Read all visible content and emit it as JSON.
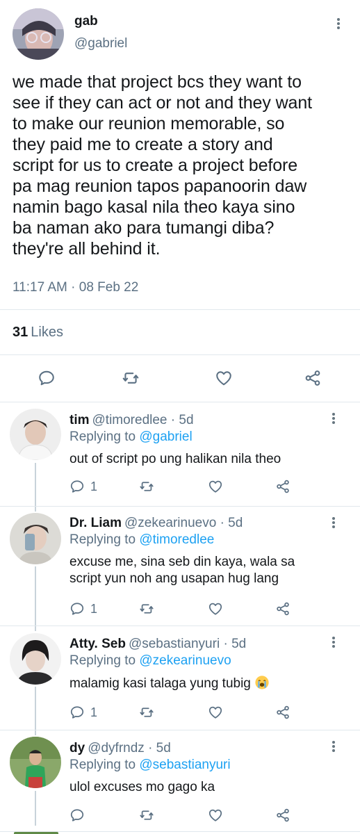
{
  "main_tweet": {
    "name": "gab",
    "handle": "@gabriel",
    "text_lines": [
      "we made that project bcs they want to",
      "see if they can act or not and they want",
      "to make our reunion memorable, so",
      "they paid me to create a story and",
      "script for us to create a project before",
      "pa mag reunion tapos papanoorin daw",
      "namin bago kasal nila theo kaya sino",
      "ba naman ako para tumangi diba?",
      "they're all behind it."
    ],
    "timestamp": "11:17 AM · 08 Feb 22",
    "likes_count": "31",
    "likes_label": "Likes",
    "icons": {
      "reply": "reply-icon",
      "retweet": "retweet-icon",
      "like": "heart-icon",
      "share": "share-icon",
      "more": "more-options-icon"
    }
  },
  "replies": [
    {
      "name": "tim",
      "handle": "@timoredlee",
      "time": "· 5d",
      "replying_prefix": "Replying to",
      "replying_to": "@gabriel",
      "text_lines": [
        "out of script po ung halikan nila theo"
      ],
      "reply_count": "1"
    },
    {
      "name": "Dr. Liam",
      "handle": "@zekearinuevo",
      "time": "· 5d",
      "replying_prefix": "Replying to",
      "replying_to": "@timoredlee",
      "text_lines": [
        "excuse me, sina seb din kaya, wala sa",
        "script yun noh ang usapan hug lang"
      ],
      "reply_count": "1"
    },
    {
      "name": "Atty. Seb",
      "handle": "@sebastianyuri",
      "time": "· 5d",
      "replying_prefix": "Replying to",
      "replying_to": "@zekearinuevo",
      "text_lines": [
        "malamig kasi talaga yung tubig"
      ],
      "emoji": "loudly-crying-face-emoji",
      "reply_count": "1"
    },
    {
      "name": "dy",
      "handle": "@dyfrndz",
      "time": "· 5d",
      "replying_prefix": "Replying to",
      "replying_to": "@sebastianyuri",
      "text_lines": [
        "ulol excuses mo gago ka"
      ],
      "reply_count": ""
    }
  ],
  "colors": {
    "link": "#1da1f2",
    "secondary_text": "#5b7083",
    "divider": "#e1e8ed"
  }
}
